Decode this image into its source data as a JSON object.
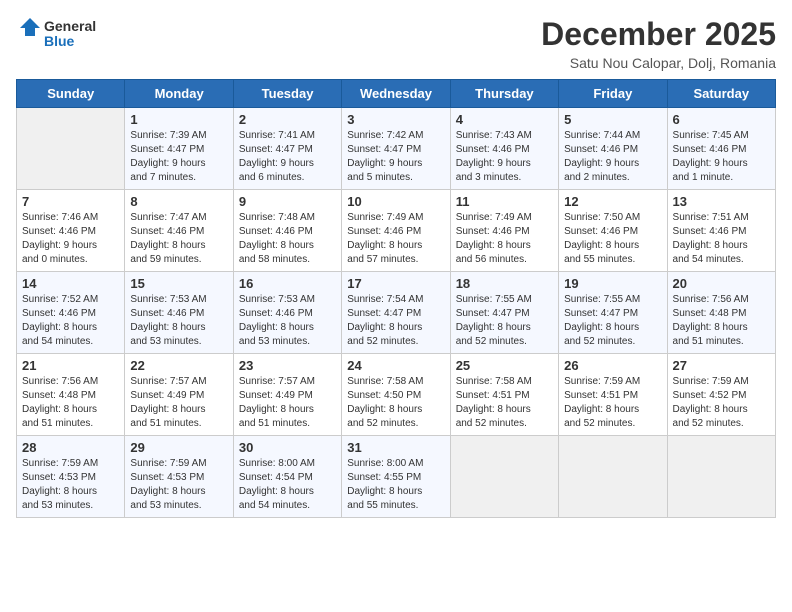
{
  "header": {
    "logo_general": "General",
    "logo_blue": "Blue",
    "month": "December 2025",
    "location": "Satu Nou Calopar, Dolj, Romania"
  },
  "days_of_week": [
    "Sunday",
    "Monday",
    "Tuesday",
    "Wednesday",
    "Thursday",
    "Friday",
    "Saturday"
  ],
  "weeks": [
    [
      {
        "day": "",
        "content": ""
      },
      {
        "day": "1",
        "content": "Sunrise: 7:39 AM\nSunset: 4:47 PM\nDaylight: 9 hours\nand 7 minutes."
      },
      {
        "day": "2",
        "content": "Sunrise: 7:41 AM\nSunset: 4:47 PM\nDaylight: 9 hours\nand 6 minutes."
      },
      {
        "day": "3",
        "content": "Sunrise: 7:42 AM\nSunset: 4:47 PM\nDaylight: 9 hours\nand 5 minutes."
      },
      {
        "day": "4",
        "content": "Sunrise: 7:43 AM\nSunset: 4:46 PM\nDaylight: 9 hours\nand 3 minutes."
      },
      {
        "day": "5",
        "content": "Sunrise: 7:44 AM\nSunset: 4:46 PM\nDaylight: 9 hours\nand 2 minutes."
      },
      {
        "day": "6",
        "content": "Sunrise: 7:45 AM\nSunset: 4:46 PM\nDaylight: 9 hours\nand 1 minute."
      }
    ],
    [
      {
        "day": "7",
        "content": "Sunrise: 7:46 AM\nSunset: 4:46 PM\nDaylight: 9 hours\nand 0 minutes."
      },
      {
        "day": "8",
        "content": "Sunrise: 7:47 AM\nSunset: 4:46 PM\nDaylight: 8 hours\nand 59 minutes."
      },
      {
        "day": "9",
        "content": "Sunrise: 7:48 AM\nSunset: 4:46 PM\nDaylight: 8 hours\nand 58 minutes."
      },
      {
        "day": "10",
        "content": "Sunrise: 7:49 AM\nSunset: 4:46 PM\nDaylight: 8 hours\nand 57 minutes."
      },
      {
        "day": "11",
        "content": "Sunrise: 7:49 AM\nSunset: 4:46 PM\nDaylight: 8 hours\nand 56 minutes."
      },
      {
        "day": "12",
        "content": "Sunrise: 7:50 AM\nSunset: 4:46 PM\nDaylight: 8 hours\nand 55 minutes."
      },
      {
        "day": "13",
        "content": "Sunrise: 7:51 AM\nSunset: 4:46 PM\nDaylight: 8 hours\nand 54 minutes."
      }
    ],
    [
      {
        "day": "14",
        "content": "Sunrise: 7:52 AM\nSunset: 4:46 PM\nDaylight: 8 hours\nand 54 minutes."
      },
      {
        "day": "15",
        "content": "Sunrise: 7:53 AM\nSunset: 4:46 PM\nDaylight: 8 hours\nand 53 minutes."
      },
      {
        "day": "16",
        "content": "Sunrise: 7:53 AM\nSunset: 4:46 PM\nDaylight: 8 hours\nand 53 minutes."
      },
      {
        "day": "17",
        "content": "Sunrise: 7:54 AM\nSunset: 4:47 PM\nDaylight: 8 hours\nand 52 minutes."
      },
      {
        "day": "18",
        "content": "Sunrise: 7:55 AM\nSunset: 4:47 PM\nDaylight: 8 hours\nand 52 minutes."
      },
      {
        "day": "19",
        "content": "Sunrise: 7:55 AM\nSunset: 4:47 PM\nDaylight: 8 hours\nand 52 minutes."
      },
      {
        "day": "20",
        "content": "Sunrise: 7:56 AM\nSunset: 4:48 PM\nDaylight: 8 hours\nand 51 minutes."
      }
    ],
    [
      {
        "day": "21",
        "content": "Sunrise: 7:56 AM\nSunset: 4:48 PM\nDaylight: 8 hours\nand 51 minutes."
      },
      {
        "day": "22",
        "content": "Sunrise: 7:57 AM\nSunset: 4:49 PM\nDaylight: 8 hours\nand 51 minutes."
      },
      {
        "day": "23",
        "content": "Sunrise: 7:57 AM\nSunset: 4:49 PM\nDaylight: 8 hours\nand 51 minutes."
      },
      {
        "day": "24",
        "content": "Sunrise: 7:58 AM\nSunset: 4:50 PM\nDaylight: 8 hours\nand 52 minutes."
      },
      {
        "day": "25",
        "content": "Sunrise: 7:58 AM\nSunset: 4:51 PM\nDaylight: 8 hours\nand 52 minutes."
      },
      {
        "day": "26",
        "content": "Sunrise: 7:59 AM\nSunset: 4:51 PM\nDaylight: 8 hours\nand 52 minutes."
      },
      {
        "day": "27",
        "content": "Sunrise: 7:59 AM\nSunset: 4:52 PM\nDaylight: 8 hours\nand 52 minutes."
      }
    ],
    [
      {
        "day": "28",
        "content": "Sunrise: 7:59 AM\nSunset: 4:53 PM\nDaylight: 8 hours\nand 53 minutes."
      },
      {
        "day": "29",
        "content": "Sunrise: 7:59 AM\nSunset: 4:53 PM\nDaylight: 8 hours\nand 53 minutes."
      },
      {
        "day": "30",
        "content": "Sunrise: 8:00 AM\nSunset: 4:54 PM\nDaylight: 8 hours\nand 54 minutes."
      },
      {
        "day": "31",
        "content": "Sunrise: 8:00 AM\nSunset: 4:55 PM\nDaylight: 8 hours\nand 55 minutes."
      },
      {
        "day": "",
        "content": ""
      },
      {
        "day": "",
        "content": ""
      },
      {
        "day": "",
        "content": ""
      }
    ]
  ]
}
